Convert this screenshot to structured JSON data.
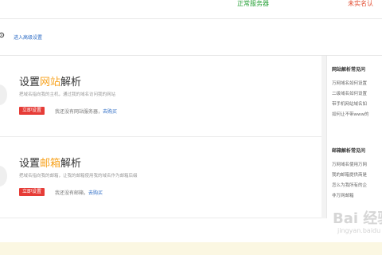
{
  "top": {
    "status_ok": "正常服务器",
    "status_warn": "未实名认"
  },
  "advanced": {
    "link": "进入高级设置"
  },
  "cards": {
    "web": {
      "title_prefix": "设置",
      "title_highlight": "网站",
      "title_suffix": "解析",
      "desc": "把域名指向我的主机，通过我的域名访问我的网站",
      "button": "立即设置",
      "note": "我还没有网站服务器，",
      "note_link": "去购买"
    },
    "mail": {
      "title_prefix": "设置",
      "title_highlight": "邮箱",
      "title_suffix": "解析",
      "desc": "把域名指向我的邮箱，让我的邮箱使用我的域名作为邮箱后缀",
      "button": "立即设置",
      "note": "我还没有邮箱，",
      "note_link": "去购买"
    }
  },
  "sidebar": {
    "web": {
      "title": "网站解析常见问",
      "items": [
        "万网域名如何设置",
        "二级域名如何设置",
        "带手机网站域名如",
        "如何让不带www的"
      ]
    },
    "mail": {
      "title": "邮箱解析常见问",
      "items": [
        "万网域名使用万网",
        "我的邮箱提供商是",
        "怎么为我所有的企",
        "非万网邮箱"
      ]
    }
  },
  "watermark": {
    "main": "Bai 经验",
    "sub": "jingyan.baidu"
  },
  "colors": {
    "accent_orange": "#f7a21d",
    "button_red": "#e63c37",
    "link_blue": "#2d6cc5",
    "status_green": "#2aa23a",
    "status_red": "#e24b2f"
  }
}
